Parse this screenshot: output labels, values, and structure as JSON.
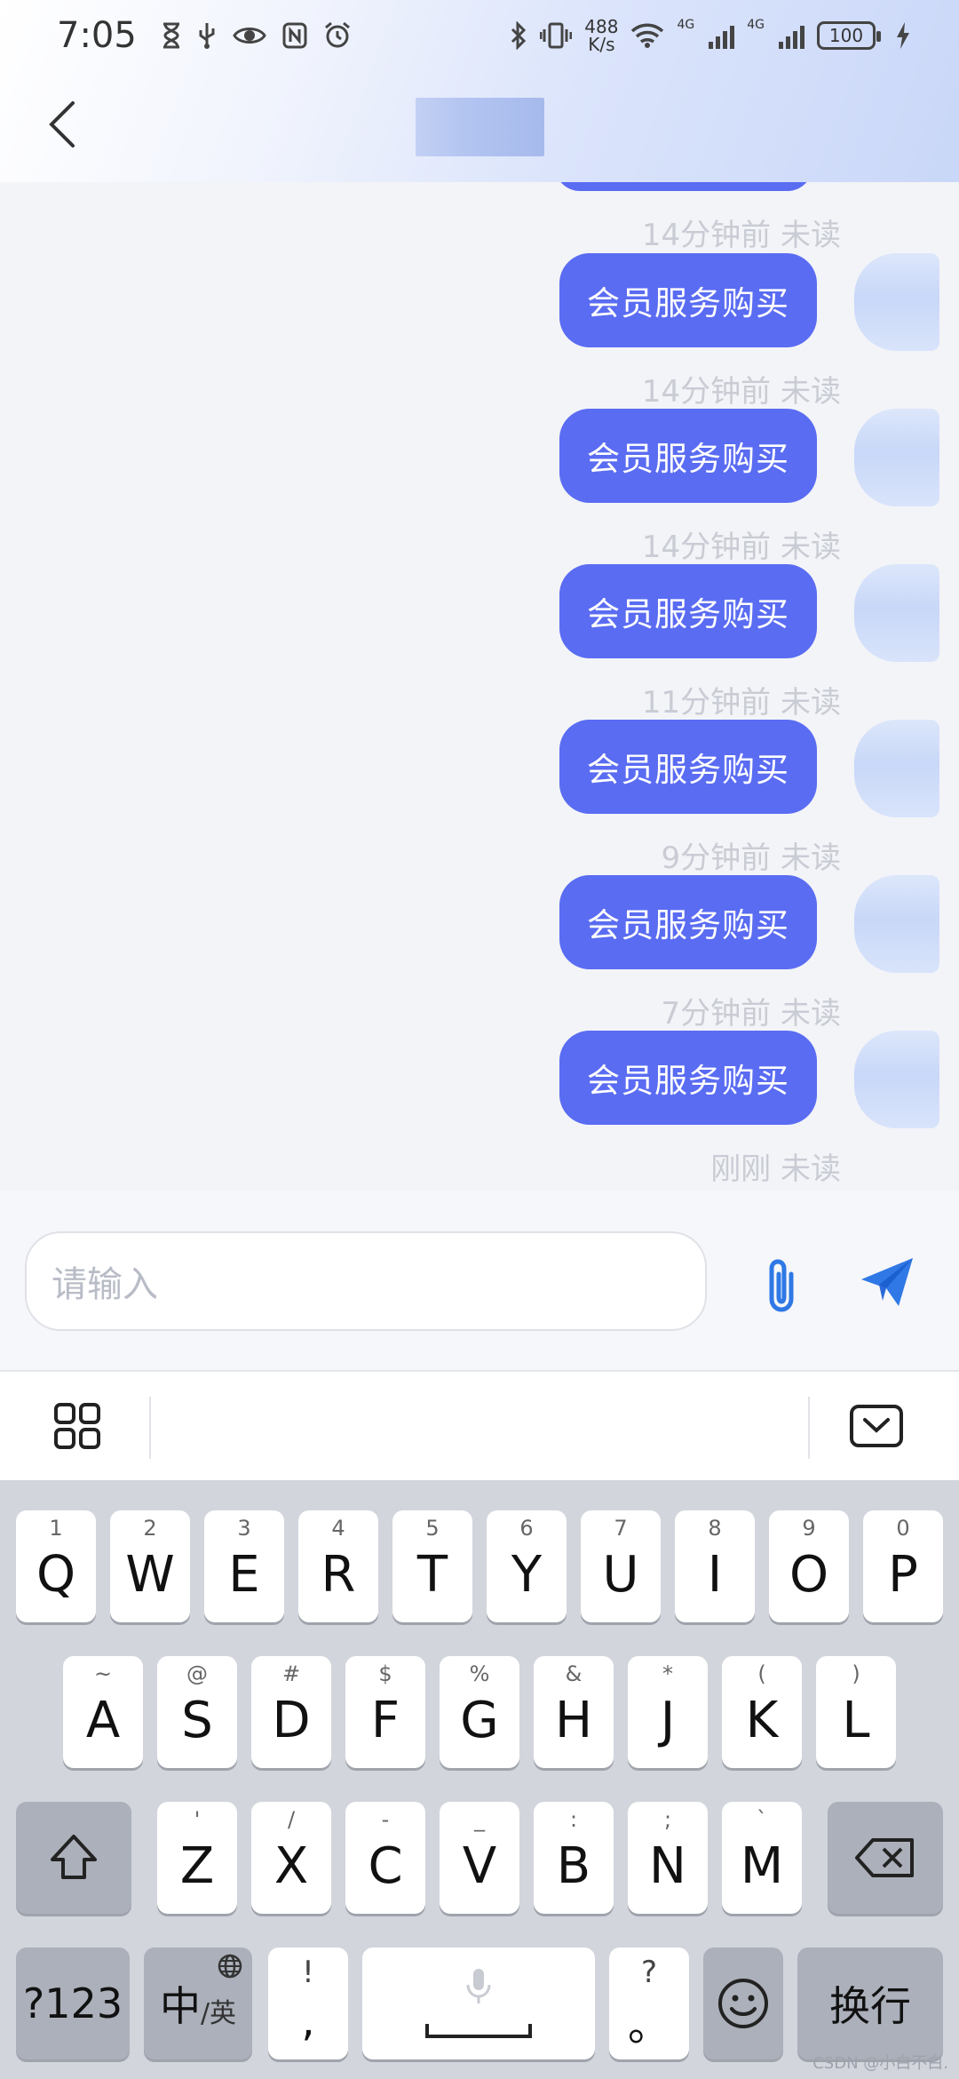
{
  "status_bar": {
    "time": "7:05",
    "net_speed_value": "488",
    "net_speed_unit": "K/s",
    "network_tag_1": "4G",
    "network_tag_2": "4G",
    "battery": "100",
    "left_icons": [
      "hourglass-icon",
      "usb-icon",
      "eye-icon",
      "nfc-icon",
      "alarm-icon"
    ],
    "right_icons": [
      "bluetooth-icon",
      "vibrate-icon",
      "wifi-icon",
      "signal-icon",
      "signal-icon",
      "battery-icon",
      "charging-icon"
    ]
  },
  "header": {
    "title": "",
    "back_icon": "chevron-left-icon"
  },
  "chat": {
    "accent_color": "#5a6cf2",
    "messages": [
      {
        "text": "会员服务购买",
        "timestamp": "14分钟前",
        "status": "未读"
      },
      {
        "text": "会员服务购买",
        "timestamp": "14分钟前",
        "status": "未读"
      },
      {
        "text": "会员服务购买",
        "timestamp": "14分钟前",
        "status": "未读"
      },
      {
        "text": "会员服务购买",
        "timestamp": "11分钟前",
        "status": "未读"
      },
      {
        "text": "会员服务购买",
        "timestamp": "9分钟前",
        "status": "未读"
      },
      {
        "text": "会员服务购买",
        "timestamp": "7分钟前",
        "status": "未读"
      },
      {
        "text": "",
        "timestamp": "刚刚",
        "status": "未读"
      }
    ],
    "first_timestamp": "14分钟前 未读"
  },
  "composer": {
    "placeholder": "请输入",
    "attach_icon": "paperclip-icon",
    "send_icon": "send-icon",
    "send_color": "#2f78e6"
  },
  "keyboard": {
    "toolbar": {
      "left_icon": "grid-icon",
      "right_icon": "keyboard-hide-icon"
    },
    "row1": [
      {
        "hint": "1",
        "key": "Q"
      },
      {
        "hint": "2",
        "key": "W"
      },
      {
        "hint": "3",
        "key": "E"
      },
      {
        "hint": "4",
        "key": "R"
      },
      {
        "hint": "5",
        "key": "T"
      },
      {
        "hint": "6",
        "key": "Y"
      },
      {
        "hint": "7",
        "key": "U"
      },
      {
        "hint": "8",
        "key": "I"
      },
      {
        "hint": "9",
        "key": "O"
      },
      {
        "hint": "0",
        "key": "P"
      }
    ],
    "row2": [
      {
        "hint": "~",
        "key": "A"
      },
      {
        "hint": "@",
        "key": "S"
      },
      {
        "hint": "#",
        "key": "D"
      },
      {
        "hint": "$",
        "key": "F"
      },
      {
        "hint": "%",
        "key": "G"
      },
      {
        "hint": "&",
        "key": "H"
      },
      {
        "hint": "*",
        "key": "J"
      },
      {
        "hint": "(",
        "key": "K"
      },
      {
        "hint": ")",
        "key": "L"
      }
    ],
    "row3": [
      {
        "hint": "'",
        "key": "Z"
      },
      {
        "hint": "/",
        "key": "X"
      },
      {
        "hint": "-",
        "key": "C"
      },
      {
        "hint": "_",
        "key": "V"
      },
      {
        "hint": ":",
        "key": "B"
      },
      {
        "hint": ";",
        "key": "N"
      },
      {
        "hint": "`",
        "key": "M"
      }
    ],
    "shift_icon": "shift-icon",
    "backspace_icon": "backspace-icon",
    "symbols_label": "?123",
    "lang_main": "中",
    "lang_alt": "/英",
    "globe_icon": "globe-icon",
    "comma_hint": "!",
    "comma_key": ",",
    "mic_icon": "microphone-icon",
    "space_icon": "space-icon",
    "period_hint": "?",
    "period_key": "。",
    "emoji_icon": "smiley-icon",
    "enter_label": "换行"
  },
  "watermark": "CSDN @小白不白."
}
